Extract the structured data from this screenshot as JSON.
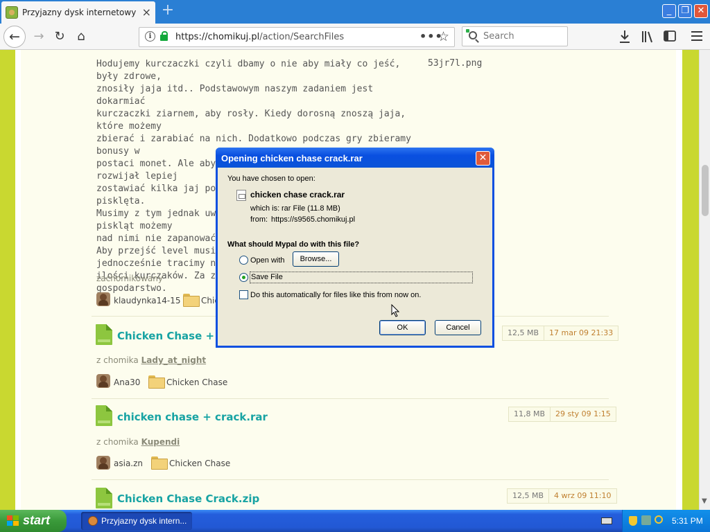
{
  "browser": {
    "tab_title": "Przyjazny dysk internetowy - Chomikuj.pl",
    "tab_close": "×",
    "new_tab": "+",
    "url_host": "https://chomikuj.pl",
    "url_path": "/action/SearchFiles",
    "url_more": "•••",
    "bookmark_star": "☆",
    "search_placeholder": "Search",
    "window_min": "_",
    "window_max": "❐",
    "window_close": "✕"
  },
  "nav": {
    "back": "←",
    "forward": "→",
    "reload": "↻",
    "home": "⌂"
  },
  "page": {
    "description": [
      "Hodujemy kurczaczki czyli dbamy o nie aby miały co jeść, były zdrowe,",
      "znosiły jaja itd.. Podstawowym naszym zadaniem jest dokarmiać",
      "kurczaczki ziarnem, aby rosły. Kiedy dorosną znoszą jaja, które możemy",
      "zbierać i zarabiać na nich. Dodatkowo podczas gry zbieramy bonusy w",
      "postaci monet. Ale aby nasz kurzy interes lepiej się rozwijał lepiej",
      "zostawiać kilka jaj po to aby potem wykluły się z nich młode pisklęta.",
      "Musimy z tym jednak uważać bo gdy dorobimy się za dużo piskląt możemy",
      "nad nimi nie zapanować - n",
      "Aby przejść level musimy u",
      "jednocześnie tracimy np. n",
      "ilości kurczaków. Za zarobi",
      "gospodarstwo."
    ],
    "side_filename": "53jr7l.png",
    "zachomikowany_label": "zachomikowany",
    "first_user": "klaudynka14-15",
    "first_folder": "Chic",
    "results": [
      {
        "name": "Chicken Chase + Cra",
        "from_label": "z chomika",
        "from_user": "Lady_at_night",
        "user": "Ana30",
        "folder": "Chicken Chase",
        "size": "12,5 MB",
        "date": "17 mar 09 21:33"
      },
      {
        "name": "chicken chase + crack.rar",
        "from_label": "z chomika",
        "from_user": "Kupendi",
        "user": "asia.zn",
        "folder": "Chicken Chase",
        "size": "11,8 MB",
        "date": "29 sty 09 1:15"
      },
      {
        "name": "Chicken Chase Crack.zip",
        "size": "12,5 MB",
        "date": "4 wrz 09 11:10"
      }
    ]
  },
  "dialog": {
    "title": "Opening chicken chase crack.rar",
    "close": "✕",
    "chosen_label": "You have chosen to open:",
    "filename": "chicken chase crack.rar",
    "which_is_label": "which is:",
    "which_is_value": "rar File (11.8 MB)",
    "from_label": "from:",
    "from_value": "https://s9565.chomikuj.pl",
    "question": "What should Mypal do with this file?",
    "open_with_label": "Open with",
    "browse_label": "Browse...",
    "save_file_label": "Save File",
    "auto_label": "Do this automatically for files like this from now on.",
    "ok_label": "OK",
    "cancel_label": "Cancel",
    "selected_option": "Save File"
  },
  "taskbar": {
    "start_label": "start",
    "task_label": "Przyjazny dysk intern...",
    "clock": "5:31 PM"
  },
  "colors": {
    "page_bg": "#c9d830",
    "link_teal": "#17a3a3",
    "date_orange": "#c08030",
    "xp_blue": "#0a4fe0"
  }
}
